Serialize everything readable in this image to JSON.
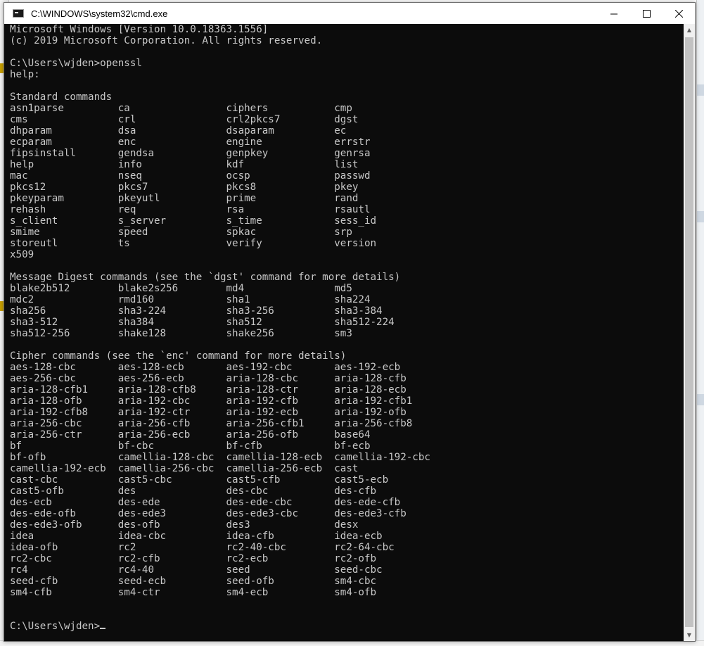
{
  "window": {
    "title": "C:\\WINDOWS\\system32\\cmd.exe",
    "minimize_glyph": "—",
    "maximize_glyph": "☐",
    "close_glyph": "✕"
  },
  "console": {
    "lines": [
      "Microsoft Windows [Version 10.0.18363.1556]",
      "(c) 2019 Microsoft Corporation. All rights reserved.",
      "",
      "C:\\Users\\wjden>openssl",
      "help:",
      "",
      "Standard commands",
      "asn1parse         ca                ciphers           cmp",
      "cms               crl               crl2pkcs7         dgst",
      "dhparam           dsa               dsaparam          ec",
      "ecparam           enc               engine            errstr",
      "fipsinstall       gendsa            genpkey           genrsa",
      "help              info              kdf               list",
      "mac               nseq              ocsp              passwd",
      "pkcs12            pkcs7             pkcs8             pkey",
      "pkeyparam         pkeyutl           prime             rand",
      "rehash            req               rsa               rsautl",
      "s_client          s_server          s_time            sess_id",
      "smime             speed             spkac             srp",
      "storeutl          ts                verify            version",
      "x509",
      "",
      "Message Digest commands (see the `dgst' command for more details)",
      "blake2b512        blake2s256        md4               md5",
      "mdc2              rmd160            sha1              sha224",
      "sha256            sha3-224          sha3-256          sha3-384",
      "sha3-512          sha384            sha512            sha512-224",
      "sha512-256        shake128          shake256          sm3",
      "",
      "Cipher commands (see the `enc' command for more details)",
      "aes-128-cbc       aes-128-ecb       aes-192-cbc       aes-192-ecb",
      "aes-256-cbc       aes-256-ecb       aria-128-cbc      aria-128-cfb",
      "aria-128-cfb1     aria-128-cfb8     aria-128-ctr      aria-128-ecb",
      "aria-128-ofb      aria-192-cbc      aria-192-cfb      aria-192-cfb1",
      "aria-192-cfb8     aria-192-ctr      aria-192-ecb      aria-192-ofb",
      "aria-256-cbc      aria-256-cfb      aria-256-cfb1     aria-256-cfb8",
      "aria-256-ctr      aria-256-ecb      aria-256-ofb      base64",
      "bf                bf-cbc            bf-cfb            bf-ecb",
      "bf-ofb            camellia-128-cbc  camellia-128-ecb  camellia-192-cbc",
      "camellia-192-ecb  camellia-256-cbc  camellia-256-ecb  cast",
      "cast-cbc          cast5-cbc         cast5-cfb         cast5-ecb",
      "cast5-ofb         des               des-cbc           des-cfb",
      "des-ecb           des-ede           des-ede-cbc       des-ede-cfb",
      "des-ede-ofb       des-ede3          des-ede3-cbc      des-ede3-cfb",
      "des-ede3-ofb      des-ofb           des3              desx",
      "idea              idea-cbc          idea-cfb          idea-ecb",
      "idea-ofb          rc2               rc2-40-cbc        rc2-64-cbc",
      "rc2-cbc           rc2-cfb           rc2-ecb           rc2-ofb",
      "rc4               rc4-40            seed              seed-cbc",
      "seed-cfb          seed-ecb          seed-ofb          sm4-cbc",
      "sm4-cfb           sm4-ctr           sm4-ecb           sm4-ofb",
      "",
      ""
    ],
    "prompt": "C:\\Users\\wjden>"
  },
  "colors": {
    "console_bg": "#0c0c0c",
    "console_fg": "#c8c8c8",
    "titlebar_bg": "#ffffff"
  },
  "icons": {
    "app": "console-app-icon",
    "minimize": "minimize-icon",
    "maximize": "maximize-icon",
    "close": "close-icon",
    "scroll_up": "scroll-up-arrow-icon",
    "scroll_down": "scroll-down-arrow-icon"
  }
}
